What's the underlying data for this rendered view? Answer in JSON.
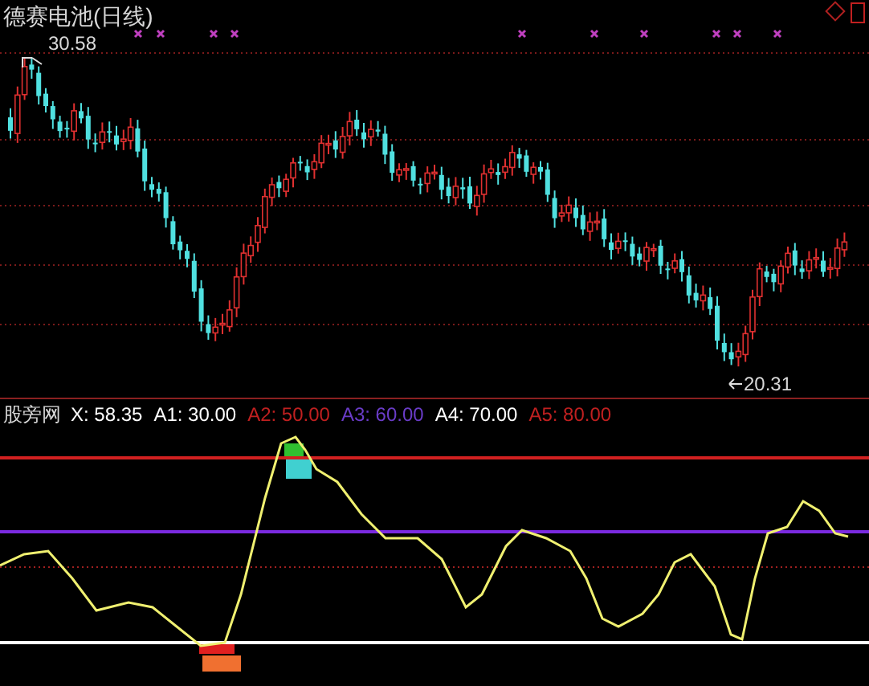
{
  "price_panel": {
    "title": "德赛电池(日线)",
    "high_label": "30.58",
    "low_label": "20.31"
  },
  "indicator_panel": {
    "name": "股旁网",
    "values": [
      {
        "text": "X: 58.35",
        "color": "#ffffff"
      },
      {
        "text": "A1: 30.00",
        "color": "#ffffff"
      },
      {
        "text": "A2: 50.00",
        "color": "#c02020"
      },
      {
        "text": "A3: 60.00",
        "color": "#6a3cc8"
      },
      {
        "text": "A4: 70.00",
        "color": "#ffffff"
      },
      {
        "text": "A5: 80.00",
        "color": "#c02020"
      }
    ]
  }
}
